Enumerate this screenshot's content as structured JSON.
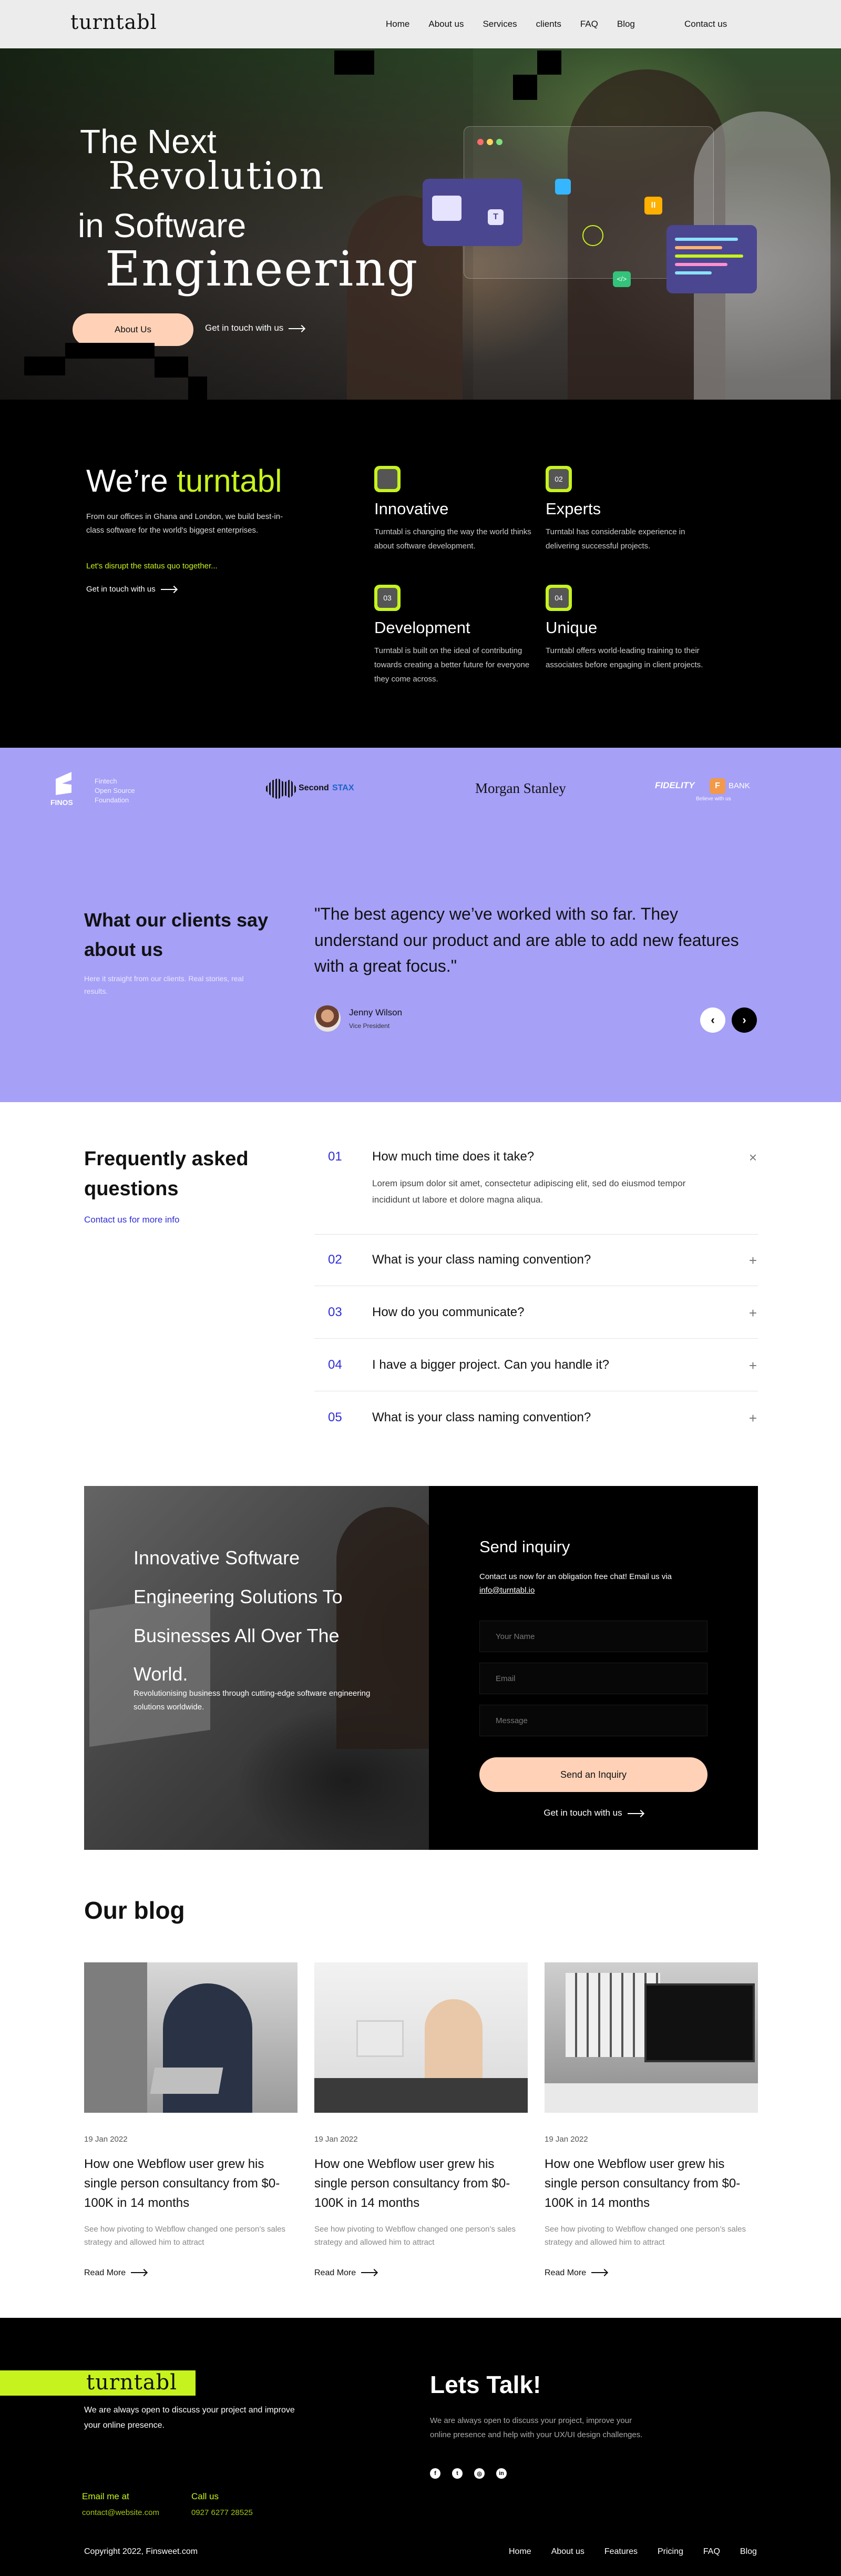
{
  "nav": {
    "logo": "turntabl",
    "links": [
      "Home",
      "About us",
      "Services",
      "clients",
      "FAQ",
      "Blog"
    ],
    "contact": "Contact us"
  },
  "hero": {
    "line1": "The Next",
    "line2": "Revolution",
    "line3": "in Software",
    "line4": "Engineering",
    "about_button": "About Us",
    "touch_link": "Get in touch with us"
  },
  "features": {
    "title_prefix": "We’re ",
    "title_brand": "turntabl",
    "description": "From our offices in Ghana and London, we build best-in-class software for the world's biggest enterprises.",
    "disrupt": "Let's disrupt the status quo together...",
    "touch_link": "Get in touch with us",
    "items": [
      {
        "num": "01",
        "title": "Innovative",
        "text": "Turntabl is changing the way the world thinks about software development."
      },
      {
        "num": "02",
        "title": "Experts",
        "text": "Turntabl has considerable experience in delivering successful projects."
      },
      {
        "num": "03",
        "title": "Development",
        "text": "Turntabl is built on the ideal of contributing towards creating a better future for everyone they come across."
      },
      {
        "num": "04",
        "title": "Unique",
        "text": "Turntabl offers world-leading training to their associates before engaging in client projects."
      }
    ]
  },
  "clients": {
    "logos": {
      "finos_mark": "FINOS",
      "finos_text": [
        "Fintech",
        "Open Source",
        "Foundation"
      ],
      "secondstax_a": "Second",
      "secondstax_b": "STAX",
      "morgan": "Morgan Stanley",
      "fidelity": "FIDELITY",
      "fidelity_bank": "BANK",
      "fidelity_tag": "Believe with us"
    },
    "title": "What our clients say about us",
    "subtitle": "Here it straight from our clients. Real stories, real results.",
    "quote": "\"The best agency we’ve worked with so far. They understand our product and are able to add new features with a great focus.\"",
    "person_name": "Jenny Wilson",
    "person_role": "Vice President"
  },
  "faq": {
    "title": "Frequently asked questions",
    "contact_link": "Contact us for more info",
    "items": [
      {
        "num": "01",
        "question": "How much time does it take?",
        "answer": "Lorem ipsum dolor sit amet, consectetur adipiscing elit, sed do eiusmod tempor incididunt ut labore et dolore magna aliqua.",
        "icon": "×"
      },
      {
        "num": "02",
        "question": "What is your class naming convention?",
        "icon": "+"
      },
      {
        "num": "03",
        "question": "How do you communicate?",
        "icon": "+"
      },
      {
        "num": "04",
        "question": "I have a bigger project. Can you handle it?",
        "icon": "+"
      },
      {
        "num": "05",
        "question": "What is your class naming convention?",
        "icon": "+"
      }
    ]
  },
  "inquiry": {
    "headline": "Innovative Software Engineering Solutions To Businesses All Over The World.",
    "tagline": "Revolutionising business through cutting-edge software engineering solutions worldwide.",
    "form_title": "Send inquiry",
    "form_sub": "Contact us now for an obligation free chat! Email us via",
    "form_email": "info@turntabl.io",
    "name_placeholder": "Your Name",
    "email_placeholder": "Email",
    "message_placeholder": "Message",
    "send_button": "Send an Inquiry",
    "touch_link": "Get in touch with us"
  },
  "blog": {
    "title": "Our blog",
    "posts": [
      {
        "date": "19 Jan 2022",
        "title": "How one Webflow user grew his single person consultancy from $0-100K in 14 months",
        "excerpt": "See how pivoting to Webflow changed one person’s sales strategy and allowed him to attract",
        "read_more": "Read More"
      },
      {
        "date": "19 Jan 2022",
        "title": "How one Webflow user grew his single person consultancy from $0-100K in 14 months",
        "excerpt": "See how pivoting to Webflow changed one person’s sales strategy and allowed him to attract",
        "read_more": "Read More"
      },
      {
        "date": "19 Jan 2022",
        "title": "How one Webflow user grew his single person consultancy from $0-100K in 14 months",
        "excerpt": "See how pivoting to Webflow changed one person’s sales strategy and allowed him to attract",
        "read_more": "Read More"
      }
    ]
  },
  "footer": {
    "logo": "turntabl",
    "description": "We are always open to discuss your project and improve your online presence.",
    "email_label": "Email me at",
    "email_value": "contact@website.com",
    "call_label": "Call us",
    "call_value": "0927 6277 28525",
    "talk_title": "Lets Talk!",
    "talk_desc": "We are always open to discuss your project, improve your online presence and help with your UX/UI design challenges.",
    "social_icons": [
      "facebook-icon",
      "twitter-icon",
      "instagram-icon",
      "linkedin-icon"
    ],
    "copyright": "Copyright 2022, Finsweet.com",
    "links": [
      "Home",
      "About us",
      "Features",
      "Pricing",
      "FAQ",
      "Blog"
    ]
  },
  "colors": {
    "accent": "#c6f31d",
    "peach": "#ffd2b8",
    "lavender": "#a6a0f7",
    "link_blue": "#2f2cd8"
  }
}
